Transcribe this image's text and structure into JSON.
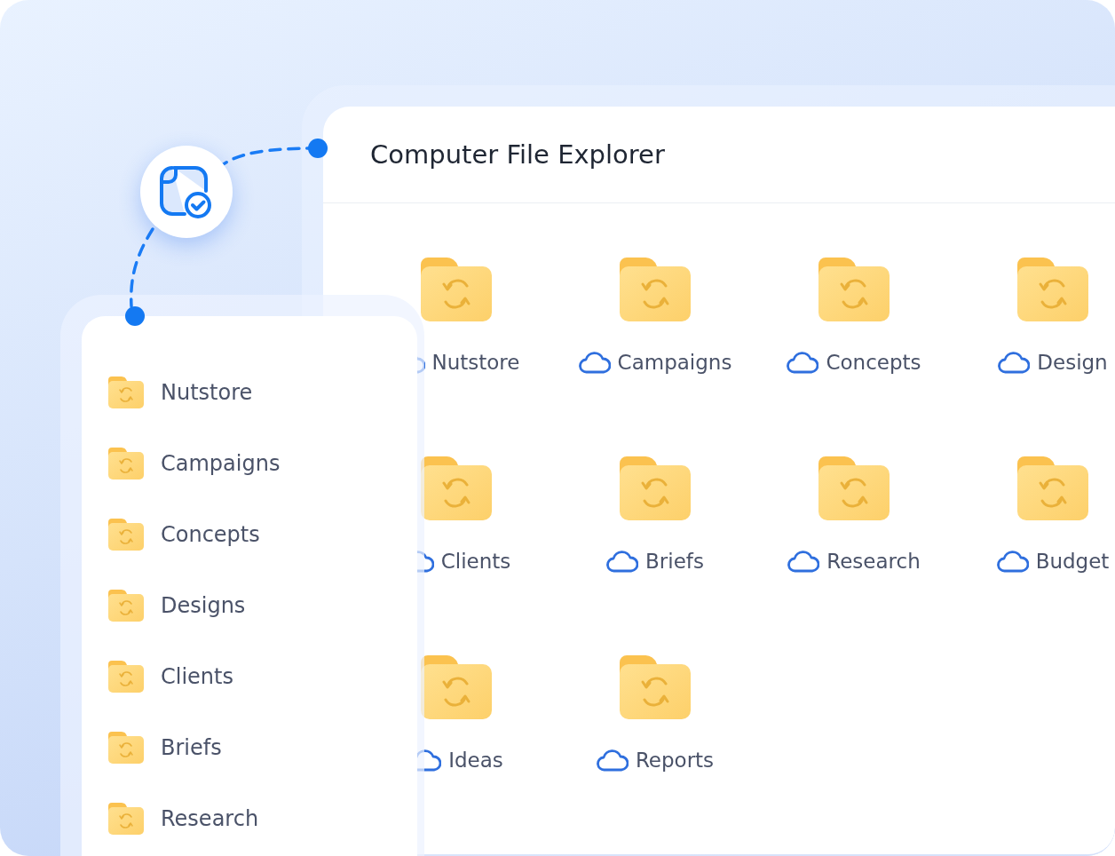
{
  "explorer": {
    "title": "Computer File Explorer",
    "folders": [
      {
        "name": "Nutstore",
        "synced": true
      },
      {
        "name": "Campaigns",
        "synced": true
      },
      {
        "name": "Concepts",
        "synced": true
      },
      {
        "name": "Design",
        "synced": true
      },
      {
        "name": "Clients",
        "synced": true
      },
      {
        "name": "Briefs",
        "synced": true
      },
      {
        "name": "Research",
        "synced": true
      },
      {
        "name": "Budget",
        "synced": true
      },
      {
        "name": "Ideas",
        "synced": true
      },
      {
        "name": "Reports",
        "synced": true
      }
    ]
  },
  "sidebar": {
    "items": [
      {
        "label": "Nutstore"
      },
      {
        "label": "Campaigns"
      },
      {
        "label": "Concepts"
      },
      {
        "label": "Designs"
      },
      {
        "label": "Clients"
      },
      {
        "label": "Briefs"
      },
      {
        "label": "Research"
      }
    ]
  }
}
